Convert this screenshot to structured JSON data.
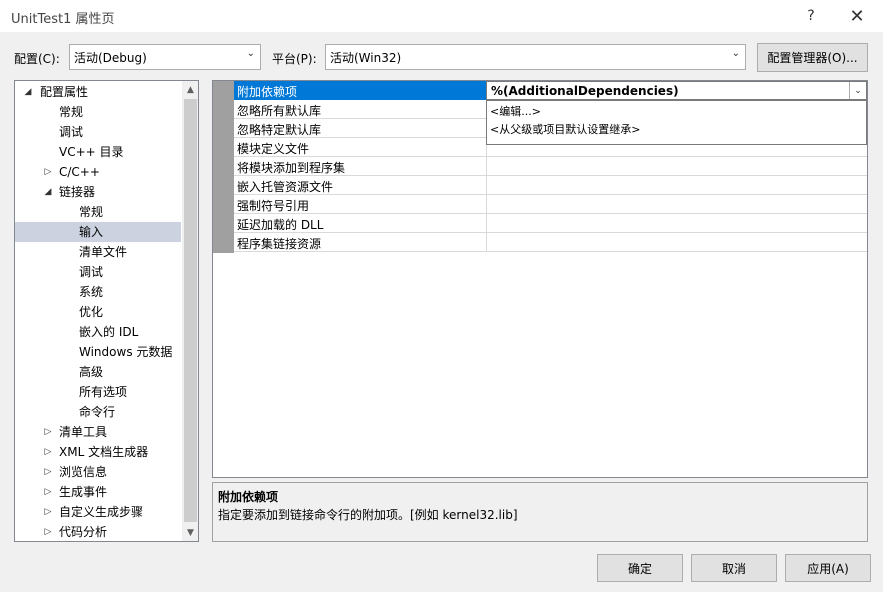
{
  "window": {
    "title": "UnitTest1 属性页",
    "help_glyph": "?",
    "close_glyph": "✕"
  },
  "config": {
    "config_label": "配置(C):",
    "config_value": "活动(Debug)",
    "platform_label": "平台(P):",
    "platform_value": "活动(Win32)",
    "manager_button": "配置管理器(O)..."
  },
  "tree": {
    "items": [
      {
        "label": "配置属性",
        "expander": "◢"
      },
      {
        "label": "常规"
      },
      {
        "label": "调试"
      },
      {
        "label": "VC++ 目录"
      },
      {
        "label": "C/C++",
        "expander": "▷"
      },
      {
        "label": "链接器",
        "expander": "◢"
      },
      {
        "label": "常规"
      },
      {
        "label": "输入"
      },
      {
        "label": "清单文件"
      },
      {
        "label": "调试"
      },
      {
        "label": "系统"
      },
      {
        "label": "优化"
      },
      {
        "label": "嵌入的 IDL"
      },
      {
        "label": "Windows 元数据"
      },
      {
        "label": "高级"
      },
      {
        "label": "所有选项"
      },
      {
        "label": "命令行"
      },
      {
        "label": "清单工具",
        "expander": "▷"
      },
      {
        "label": "XML 文档生成器",
        "expander": "▷"
      },
      {
        "label": "浏览信息",
        "expander": "▷"
      },
      {
        "label": "生成事件",
        "expander": "▷"
      },
      {
        "label": "自定义生成步骤",
        "expander": "▷"
      },
      {
        "label": "代码分析",
        "expander": "▷"
      }
    ],
    "scroll_up": "▲",
    "scroll_down": "▼"
  },
  "grid": {
    "rows": [
      {
        "name": "附加依赖项",
        "value": ""
      },
      {
        "name": "忽略所有默认库",
        "value": ""
      },
      {
        "name": "忽略特定默认库",
        "value": ""
      },
      {
        "name": "模块定义文件",
        "value": ""
      },
      {
        "name": "将模块添加到程序集",
        "value": ""
      },
      {
        "name": "嵌入托管资源文件",
        "value": ""
      },
      {
        "name": "强制符号引用",
        "value": ""
      },
      {
        "name": "延迟加载的 DLL",
        "value": ""
      },
      {
        "name": "程序集链接资源",
        "value": ""
      }
    ],
    "editor_value": "%(AdditionalDependencies)",
    "editor_drop": "⌄",
    "dropdown_options": [
      "<编辑...>",
      "<从父级或项目默认设置继承>"
    ]
  },
  "description": {
    "title": "附加依赖项",
    "text": "指定要添加到链接命令行的附加项。[例如 kernel32.lib]"
  },
  "buttons": {
    "ok": "确定",
    "cancel": "取消",
    "apply": "应用(A)"
  }
}
